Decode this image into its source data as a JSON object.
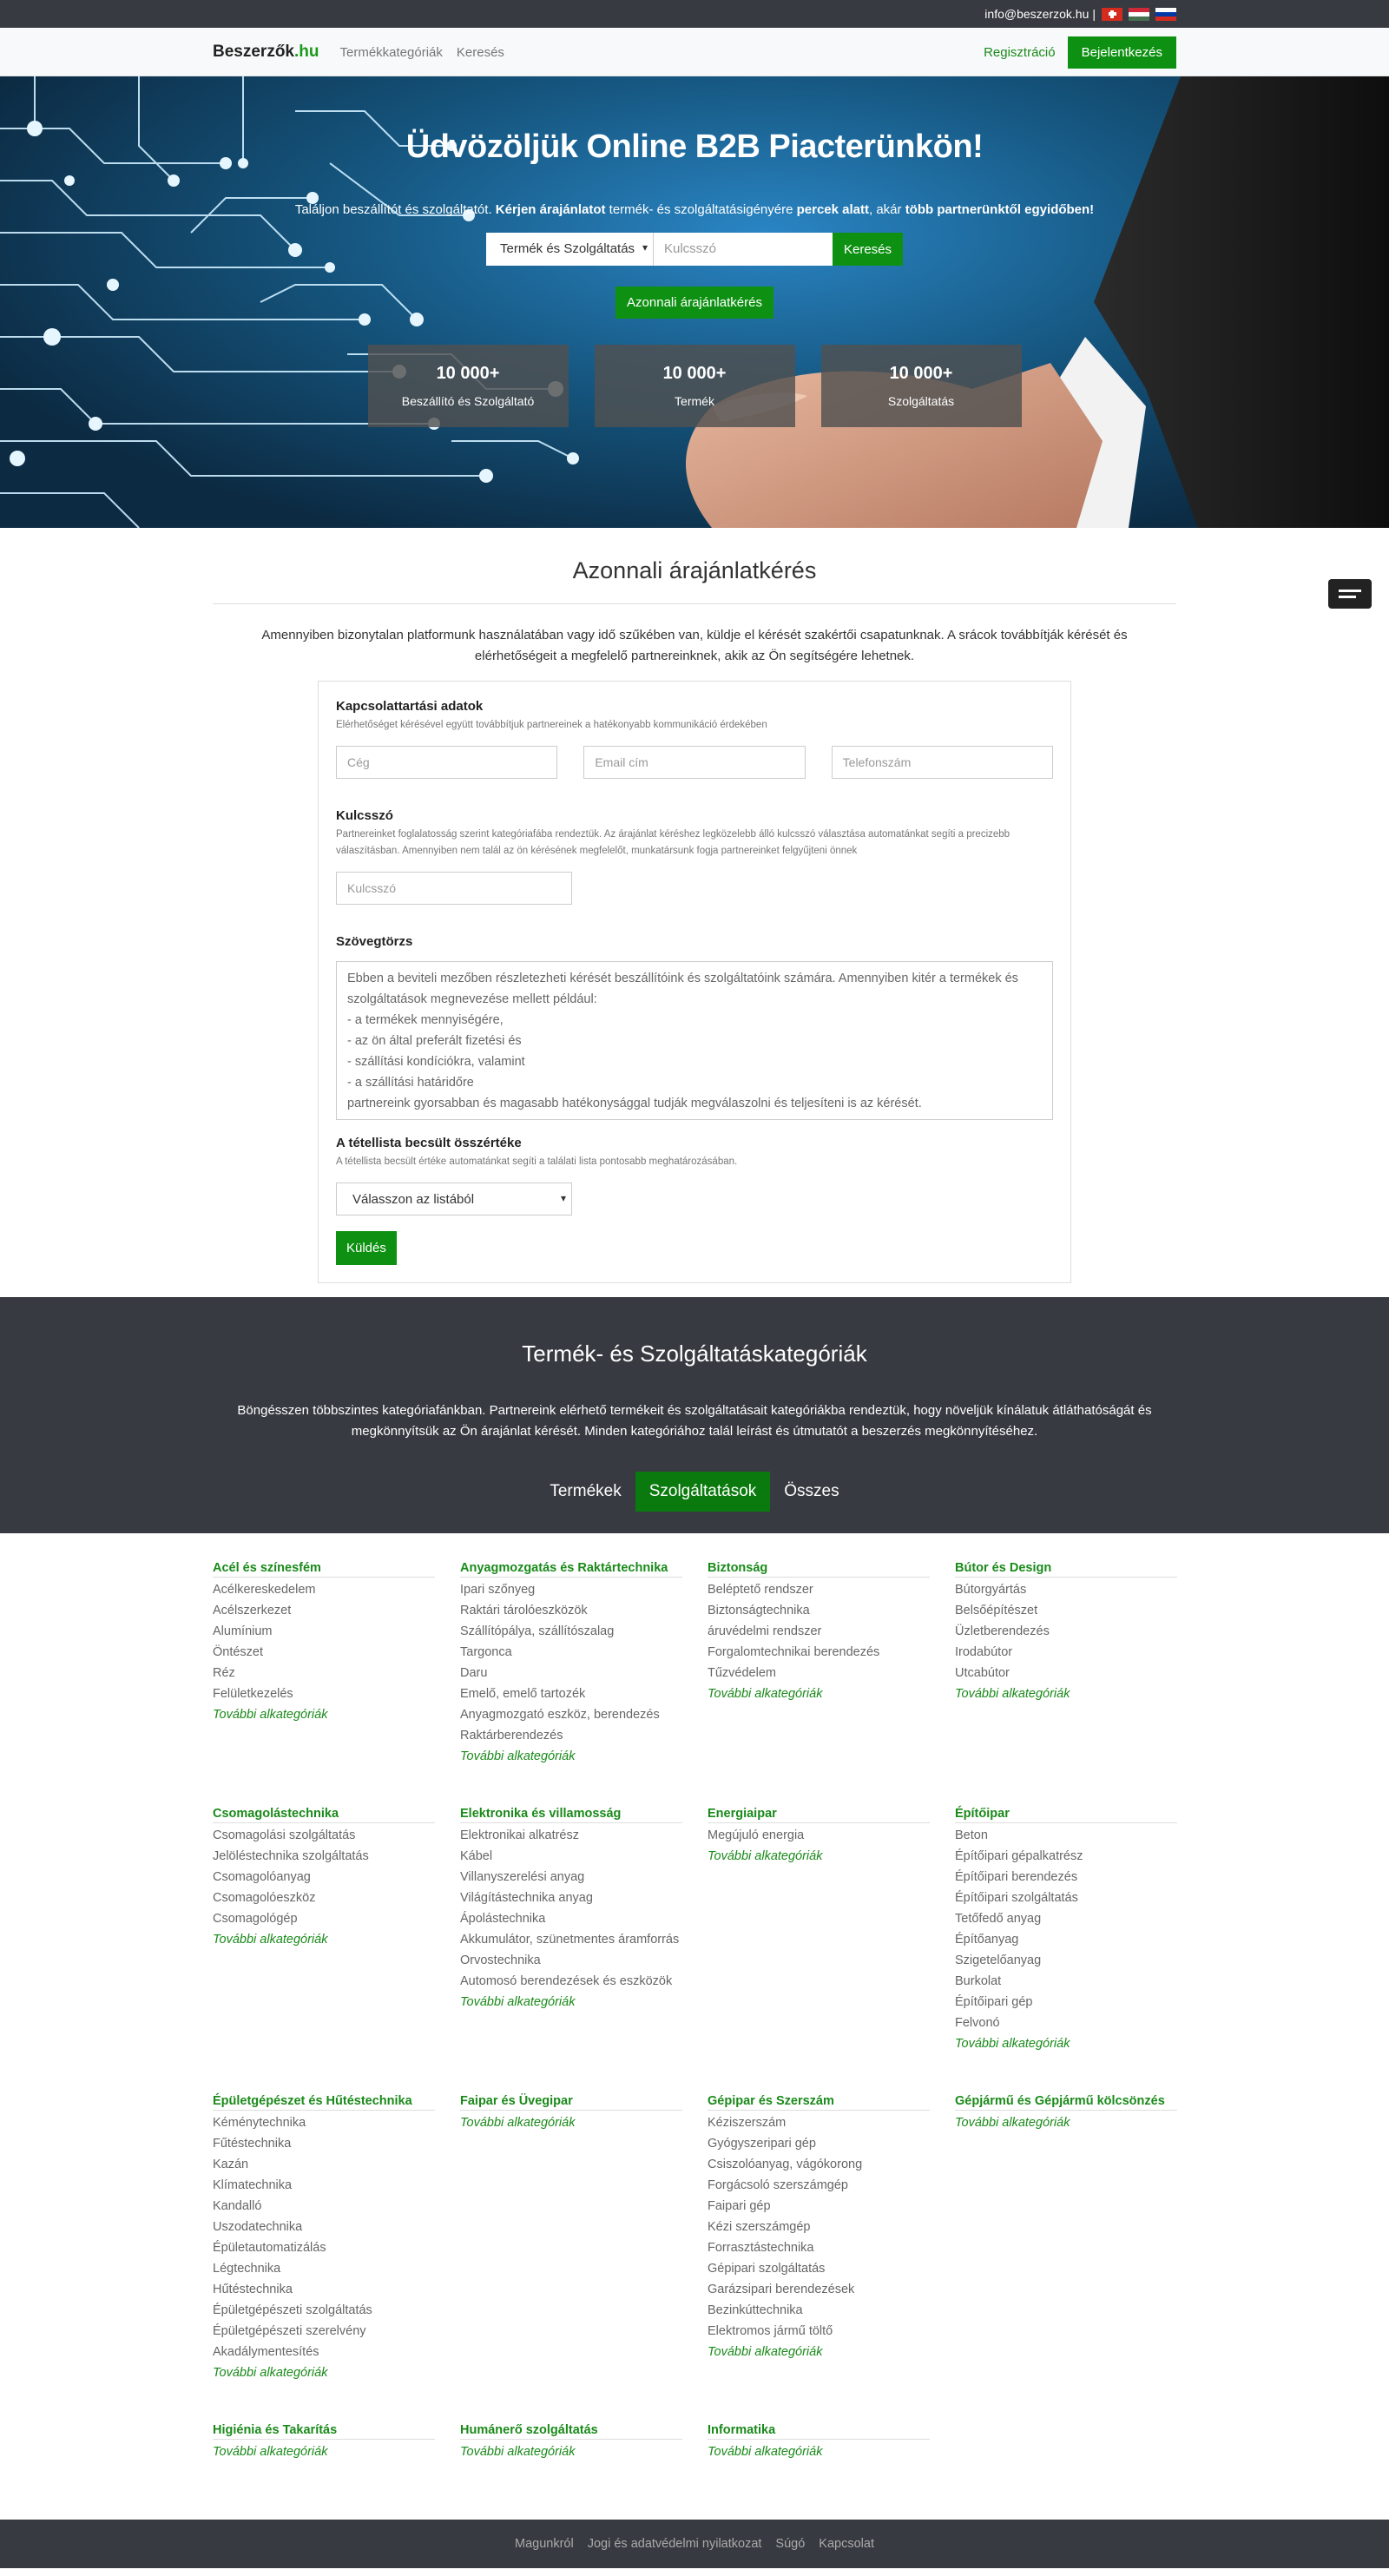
{
  "topbar": {
    "email": "info@beszerzok.hu",
    "separator": "|"
  },
  "navbar": {
    "brand_main": "Beszerzők",
    "brand_tld": ".hu",
    "links": [
      "Termékkategóriák",
      "Keresés"
    ],
    "register": "Regisztráció",
    "login": "Bejelentkezés"
  },
  "hero": {
    "title": "Üdvözöljük Online B2B Piacterünkön!",
    "subtitle_1": "Találjon beszállítót és szolgáltatót. ",
    "subtitle_2": "Kérjen árajánlatot",
    "subtitle_3": " termék- és szolgáltatásigényére ",
    "subtitle_4": "percek alatt",
    "subtitle_5": ", akár ",
    "subtitle_6": "több partnerünktől egyidőben!",
    "select_value": "Termék és Szolgáltatás",
    "keyword_placeholder": "Kulcsszó",
    "search_button": "Keresés",
    "quote_button": "Azonnali árajánlatkérés",
    "stats": [
      {
        "num": "10 000+",
        "label": "Beszállító és Szolgáltató"
      },
      {
        "num": "10 000+",
        "label": "Termék"
      },
      {
        "num": "10 000+",
        "label": "Szolgáltatás"
      }
    ]
  },
  "quote": {
    "title": "Azonnali árajánlatkérés",
    "intro": "Amennyiben bizonytalan platformunk használatában vagy idő szűkében van, küldje el kérését szakértői csapatunknak. A srácok továbbítják kérését és elérhetőségeit a megfelelő partnereinknek, akik az Ön segítségére lehetnek.",
    "contact_heading": "Kapcsolattartási adatok",
    "contact_sub": "Elérhetőséget kérésével együtt továbbítjuk partnereinek a hatékonyabb kommunikáció érdekében",
    "company_ph": "Cég",
    "email_ph": "Email cím",
    "phone_ph": "Telefonszám",
    "keyword_heading": "Kulcsszó",
    "keyword_sub": "Partnereinket foglalatosság szerint kategóriafába rendeztük. Az árajánlat kéréshez legközelebb álló kulcsszó választása automatánkat segíti a precizebb válaszításban. Amennyiben nem talál az ön kérésének megfelelőt, munkatársunk fogja partnereinket felgyűjteni önnek",
    "keyword_ph": "Kulcsszó",
    "body_heading": "Szövegtörzs",
    "body_text": "Ebben a beviteli mezőben részletezheti kérését beszállítóink és szolgáltatóink számára. Amennyiben kitér a termékek és szolgáltatások megnevezése mellett például:\n- a termékek mennyiségére,\n- az ön által preferált fizetési és\n- szállítási kondíciókra, valamint\n- a szállítási határidőre\npartnereink gyorsabban és magasabb hatékonysággal tudják megválaszolni és teljesíteni is az kérését.",
    "value_heading": "A tétellista becsült összértéke",
    "value_sub": "A tétellista becsült értéke automatánkat segíti a találati lista pontosabb meghatározásában.",
    "value_select": "Válasszon az listából",
    "send": "Küldés"
  },
  "categories": {
    "title": "Termék- és Szolgáltatáskategóriák",
    "desc": "Böngésszen többszintes kategóriafánkban. Partnereink elérhető termékeit és szolgáltatásait kategóriákba rendeztük, hogy növeljük kínálatuk átláthatóságát és megkönnyítsük az Ön árajánlat kérését. Minden kategóriához talál leírást és útmutatót a beszerzés megkönnyítéséhez.",
    "tabs": [
      "Termékek",
      "Szolgáltatások",
      "Összes"
    ],
    "more": "További alkategóriák",
    "groups": [
      {
        "h": "Acél és színesfém",
        "items": [
          "Acélkereskedelem",
          "Acélszerkezet",
          "Alumínium",
          "Öntészet",
          "Réz",
          "Felületkezelés"
        ]
      },
      {
        "h": "Anyagmozgatás és Raktártechnika",
        "items": [
          "Ipari szőnyeg",
          "Raktári tárolóeszközök",
          "Szállítópálya, szállítószalag",
          "Targonca",
          "Daru",
          "Emelő, emelő tartozék",
          "Anyagmozgató eszköz, berendezés",
          "Raktárberendezés"
        ]
      },
      {
        "h": "Biztonság",
        "items": [
          "Beléptető rendszer",
          "Biztonságtechnika",
          "áruvédelmi rendszer",
          "Forgalomtechnikai berendezés",
          "Tűzvédelem"
        ]
      },
      {
        "h": "Bútor és Design",
        "items": [
          "Bútorgyártás",
          "Belsőépítészet",
          "Üzletberendezés",
          "Irodabútor",
          "Utcabútor"
        ]
      },
      {
        "h": "Csomagolástechnika",
        "items": [
          "Csomagolási szolgáltatás",
          "Jelöléstechnika szolgáltatás",
          "Csomagolóanyag",
          "Csomagolóeszköz",
          "Csomagológép"
        ]
      },
      {
        "h": "Elektronika és villamosság",
        "items": [
          "Elektronikai alkatrész",
          "Kábel",
          "Villanyszerelési anyag",
          "Világítástechnika anyag",
          "Ápolástechnika",
          "Akkumulátor, szünetmentes áramforrás",
          "Orvostechnika",
          "Automosó berendezések és eszközök"
        ]
      },
      {
        "h": "Energiaipar",
        "items": [
          "Megújuló energia"
        ]
      },
      {
        "h": "Építőipar",
        "items": [
          "Beton",
          "Építőipari gépalkatrész",
          "Építőipari berendezés",
          "Építőipari szolgáltatás",
          "Tetőfedő anyag",
          "Építőanyag",
          "Szigetelőanyag",
          "Burkolat",
          "Építőipari gép",
          "Felvonó"
        ]
      },
      {
        "h": "Épületgépészet és Hűtéstechnika",
        "items": [
          "Kéménytechnika",
          "Fűtéstechnika",
          "Kazán",
          "Klímatechnika",
          "Kandalló",
          "Uszodatechnika",
          "Épületautomatizálás",
          "Légtechnika",
          "Hűtéstechnika",
          "Épületgépészeti szolgáltatás",
          "Épületgépészeti szerelvény",
          "Akadálymentesítés"
        ]
      },
      {
        "h": "Faipar és Üvegipar",
        "items": []
      },
      {
        "h": "Gépipar és Szerszám",
        "items": [
          "Kéziszerszám",
          "Gyógyszeripari gép",
          "Csiszolóanyag, vágókorong",
          "Forgácsoló szerszámgép",
          "Faipari gép",
          "Kézi szerszámgép",
          "Forrasztástechnika",
          "Gépipari szolgáltatás",
          "Garázsipari berendezések",
          "Bezinkúttechnika",
          "Elektromos jármű töltő"
        ]
      },
      {
        "h": "Gépjármű és Gépjármű kölcsönzés",
        "items": []
      },
      {
        "h": "Higiénia és Takarítás",
        "items": []
      },
      {
        "h": "Humánerő szolgáltatás",
        "items": []
      },
      {
        "h": "Informatika",
        "items": []
      }
    ]
  },
  "footer": {
    "links": [
      "Magunkról",
      "Jogi és adatvédelmi nyilatkozat",
      "Súgó",
      "Kapcsolat"
    ]
  }
}
